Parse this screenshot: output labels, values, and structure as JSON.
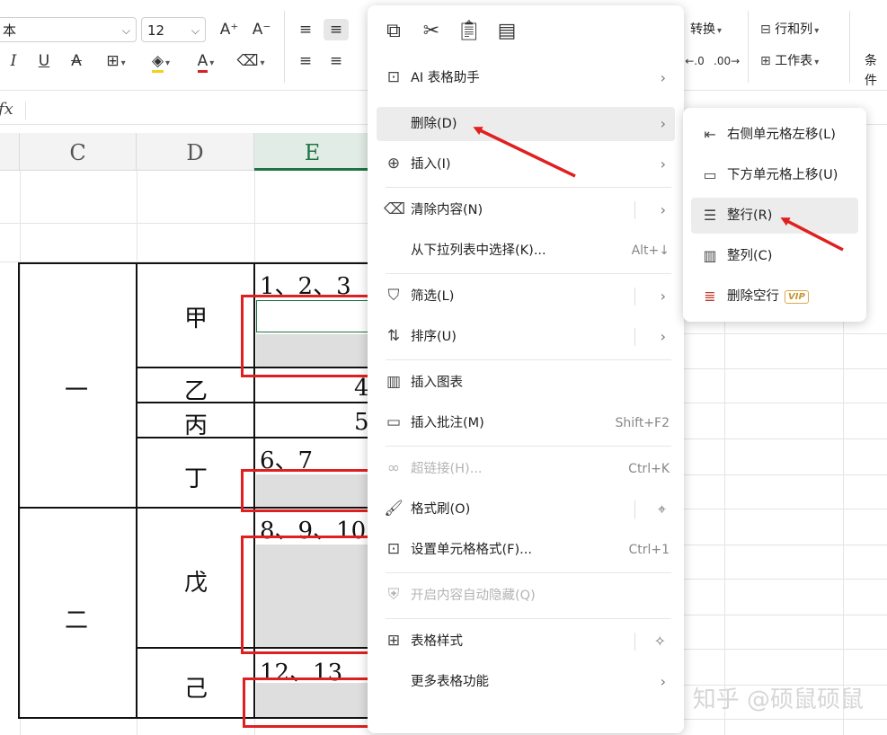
{
  "ribbon": {
    "font_name": "本",
    "font_size": "12",
    "grow_font": "A⁺",
    "shrink_font": "A⁻",
    "convert_label": "转换",
    "rows_cols_label": "行和列",
    "worksheet_label": "工作表",
    "conditional_label": "条件"
  },
  "formula_bar": {
    "fx": "fx"
  },
  "columns": [
    "C",
    "D",
    "E"
  ],
  "cells": {
    "group1": "一",
    "group2": "二",
    "r_jia": "甲",
    "r_yi": "乙",
    "r_bing": "丙",
    "r_ding": "丁",
    "r_wu": "戊",
    "r_ji": "己",
    "v_jia": "1、2、3",
    "v_yi": "4",
    "v_bing": "5",
    "v_ding": "6、7",
    "v_wu": "8、9、10",
    "v_ji": "12、13"
  },
  "context_menu": {
    "ai": "AI 表格助手",
    "delete": "删除(D)",
    "insert": "插入(I)",
    "clear": "清除内容(N)",
    "pick_list": "从下拉列表中选择(K)...",
    "pick_list_sc": "Alt+↓",
    "filter": "筛选(L)",
    "sort": "排序(U)",
    "insert_chart": "插入图表",
    "insert_comment": "插入批注(M)",
    "insert_comment_sc": "Shift+F2",
    "hyperlink": "超链接(H)...",
    "hyperlink_sc": "Ctrl+K",
    "format_painter": "格式刷(O)",
    "cell_format": "设置单元格格式(F)...",
    "cell_format_sc": "Ctrl+1",
    "auto_hide": "开启内容自动隐藏(Q)",
    "table_style": "表格样式",
    "more_table": "更多表格功能"
  },
  "submenu": {
    "shift_left": "右侧单元格左移(L)",
    "shift_up": "下方单元格上移(U)",
    "entire_row": "整行(R)",
    "entire_col": "整列(C)",
    "delete_blank_rows": "删除空行",
    "vip": "VIP"
  },
  "watermark": "知乎 @硕鼠硕鼠",
  "colors": {
    "accent_red": "#e02020",
    "highlight": "#ececec",
    "selection_green": "#217346"
  }
}
